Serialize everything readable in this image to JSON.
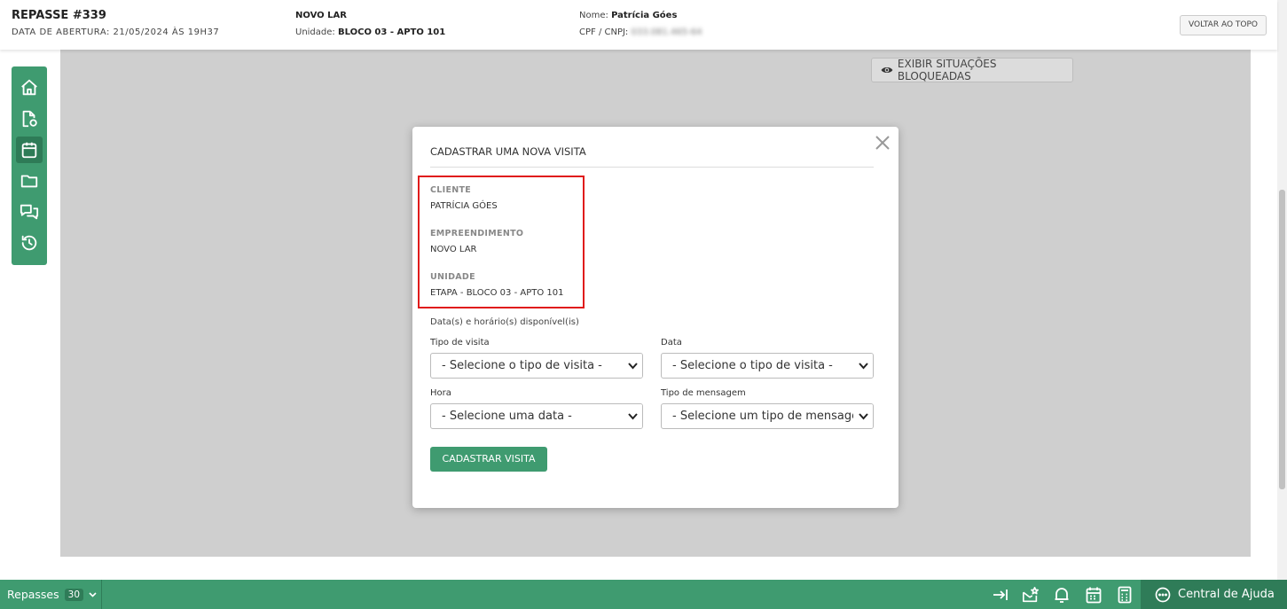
{
  "header": {
    "title": "REPASSE #339",
    "opened_label": "DATA DE ABERTURA: 21/05/2024 ÀS 19H37",
    "project": "NOVO LAR",
    "unit_label": "Unidade:",
    "unit_value": "BLOCO 03 - APTO 101",
    "name_label": "Nome:",
    "name_value": "Patrícia Góes",
    "cpf_label": "CPF / CNPJ:",
    "cpf_value": "033.081.465-64",
    "back_to_top": "VOLTAR AO TOPO"
  },
  "sidebar": {
    "items": [
      {
        "icon": "home-icon"
      },
      {
        "icon": "document-settings-icon"
      },
      {
        "icon": "calendar-icon",
        "active": true
      },
      {
        "icon": "folder-icon"
      },
      {
        "icon": "chat-icon"
      },
      {
        "icon": "history-icon"
      }
    ]
  },
  "content": {
    "show_blocked": "EXIBIR SITUAÇÕES BLOQUEADAS"
  },
  "modal": {
    "title": "CADASTRAR UMA NOVA VISITA",
    "client_label": "CLIENTE",
    "client_value": "PATRÍCIA GÓES",
    "project_label": "EMPREENDIMENTO",
    "project_value": "NOVO LAR",
    "unit_label": "UNIDADE",
    "unit_value": "ETAPA - BLOCO 03 - APTO 101",
    "available_label": "Data(s) e horário(s) disponível(is)",
    "visit_type_label": "Tipo de visita",
    "visit_type_value": "- Selecione o tipo de visita -",
    "date_label": "Data",
    "date_value": "- Selecione o tipo de visita -",
    "hour_label": "Hora",
    "hour_value": "- Selecione uma data -",
    "message_type_label": "Tipo de mensagem",
    "message_type_value": "- Selecione um tipo de mensagem -",
    "submit_label": "CADASTRAR VISITA"
  },
  "bottombar": {
    "repasses_label": "Repasses",
    "repasses_count": "30",
    "help_label": "Central de Ajuda"
  },
  "colors": {
    "brand_green": "#3f9b70",
    "brand_green_dark": "#2f7c58",
    "highlight_red": "#e01b1b"
  }
}
